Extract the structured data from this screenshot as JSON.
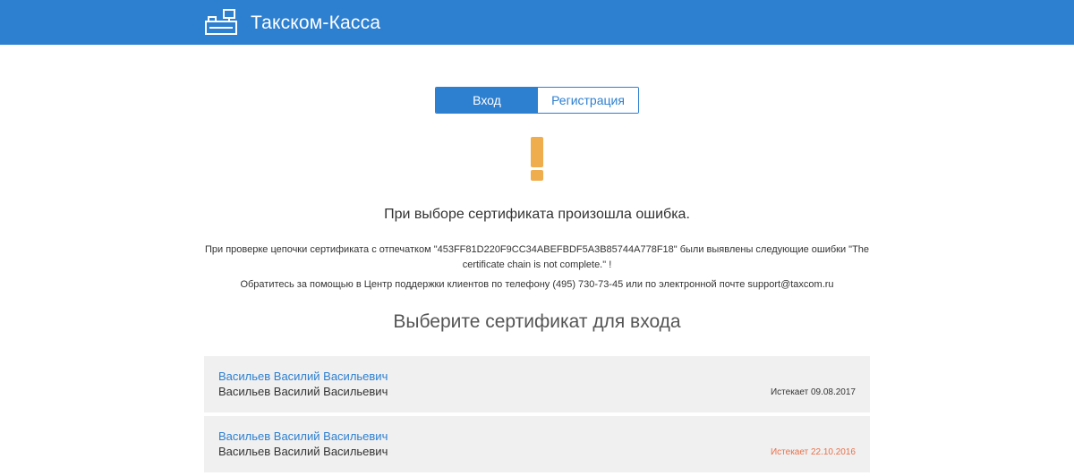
{
  "header": {
    "app_title": "Такском-Касса",
    "logo_icon": "cash-register-icon",
    "background_color": "#2d7fd0"
  },
  "tabs": {
    "login_label": "Вход",
    "register_label": "Регистрация",
    "active": "login"
  },
  "error": {
    "icon": "exclamation-icon",
    "icon_color": "#f0ad4e",
    "title": "При выборе сертификата произошла ошибка.",
    "details": "При проверке цепочки сертификата с отпечатком \"453FF81D220F9CC34ABEFBDF5A3B85744A778F18\" были выявлены следующие ошибки \"The certificate chain is not complete.\" !",
    "support": "Обратитесь за помощью в Центр поддержки клиентов по телефону (495) 730-73-45 или по электронной почте support@taxcom.ru"
  },
  "certificates": {
    "section_title": "Выберите сертификат для входа",
    "items": [
      {
        "name": "Васильев Василий Васильевич",
        "owner": "Васильев Василий Васильевич",
        "expiry": "Истекает 09.08.2017",
        "expired": false
      },
      {
        "name": "Васильев Василий Васильевич",
        "owner": "Васильев Василий Васильевич",
        "expiry": "Истекает 22.10.2016",
        "expired": true
      }
    ]
  }
}
